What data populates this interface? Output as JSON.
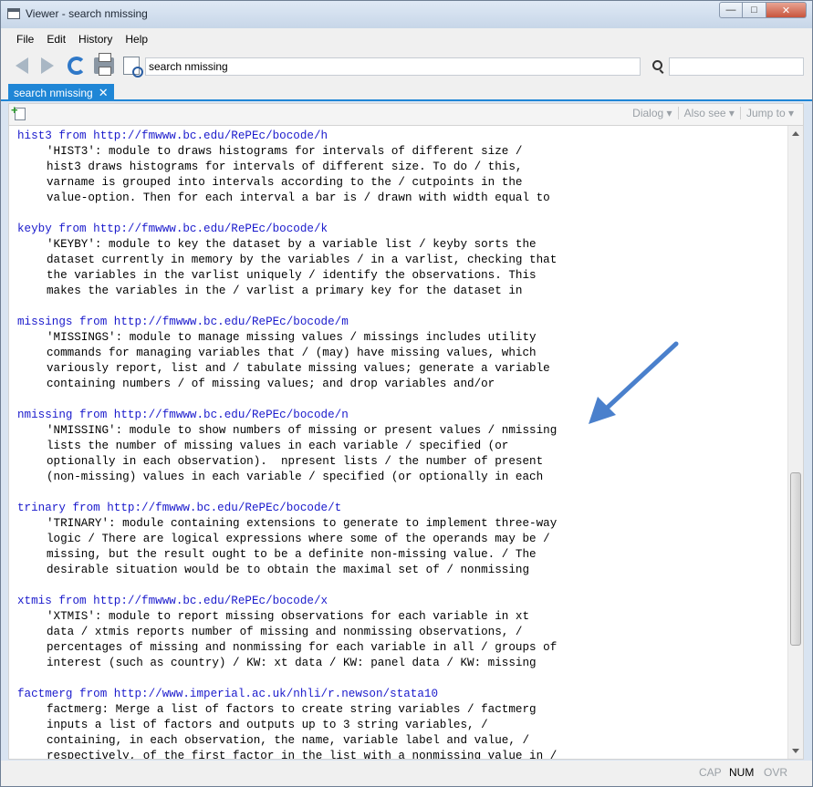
{
  "window": {
    "title": "Viewer - search nmissing"
  },
  "menu": [
    "File",
    "Edit",
    "History",
    "Help"
  ],
  "toolbar": {
    "command_value": "search nmissing",
    "find_value": ""
  },
  "tab": {
    "label": "search nmissing"
  },
  "subtoolbar": {
    "dialog": "Dialog",
    "also_see": "Also see",
    "jump_to": "Jump to"
  },
  "entries": [
    {
      "head": "hist3 from http://fmwww.bc.edu/RePEc/bocode/h",
      "lines": [
        "'HIST3': module to draws histograms for intervals of different size /",
        "hist3 draws histograms for intervals of different size. To do / this,",
        "varname is grouped into intervals according to the / cutpoints in the",
        "value-option. Then for each interval a bar is / drawn with width equal to"
      ]
    },
    {
      "head": "keyby from http://fmwww.bc.edu/RePEc/bocode/k",
      "lines": [
        "'KEYBY': module to key the dataset by a variable list / keyby sorts the",
        "dataset currently in memory by the variables / in a varlist, checking that",
        "the variables in the varlist uniquely / identify the observations. This",
        "makes the variables in the / varlist a primary key for the dataset in"
      ]
    },
    {
      "head": "missings from http://fmwww.bc.edu/RePEc/bocode/m",
      "lines": [
        "'MISSINGS': module to manage missing values / missings includes utility",
        "commands for managing variables that / (may) have missing values, which",
        "variously report, list and / tabulate missing values; generate a variable",
        "containing numbers / of missing values; and drop variables and/or"
      ]
    },
    {
      "head": "nmissing from http://fmwww.bc.edu/RePEc/bocode/n",
      "lines": [
        "'NMISSING': module to show numbers of missing or present values / nmissing",
        "lists the number of missing values in each variable / specified (or",
        "optionally in each observation).  npresent lists / the number of present",
        "(non-missing) values in each variable / specified (or optionally in each"
      ]
    },
    {
      "head": "trinary from http://fmwww.bc.edu/RePEc/bocode/t",
      "lines": [
        "'TRINARY': module containing extensions to generate to implement three-way",
        "logic / There are logical expressions where some of the operands may be /",
        "missing, but the result ought to be a definite non-missing value. / The",
        "desirable situation would be to obtain the maximal set of / nonmissing"
      ]
    },
    {
      "head": "xtmis from http://fmwww.bc.edu/RePEc/bocode/x",
      "lines": [
        "'XTMIS': module to report missing observations for each variable in xt",
        "data / xtmis reports number of missing and nonmissing observations, /",
        "percentages of missing and nonmissing for each variable in all / groups of",
        "interest (such as country) / KW: xt data / KW: panel data / KW: missing"
      ]
    },
    {
      "head": "factmerg from http://www.imperial.ac.uk/nhli/r.newson/stata10",
      "lines": [
        "factmerg: Merge a list of factors to create string variables / factmerg",
        "inputs a list of factors and outputs up to 3 string variables, /",
        "containing, in each observation, the name, variable label and value, /",
        "respectively, of the first factor in the list with a nonmissing value in /"
      ]
    }
  ],
  "status": {
    "cap": "CAP",
    "num": "NUM",
    "ovr": "OVR"
  },
  "colors": {
    "accent": "#1f86d6",
    "link": "#1a1acc",
    "annotation_arrow": "#4a80cc"
  }
}
